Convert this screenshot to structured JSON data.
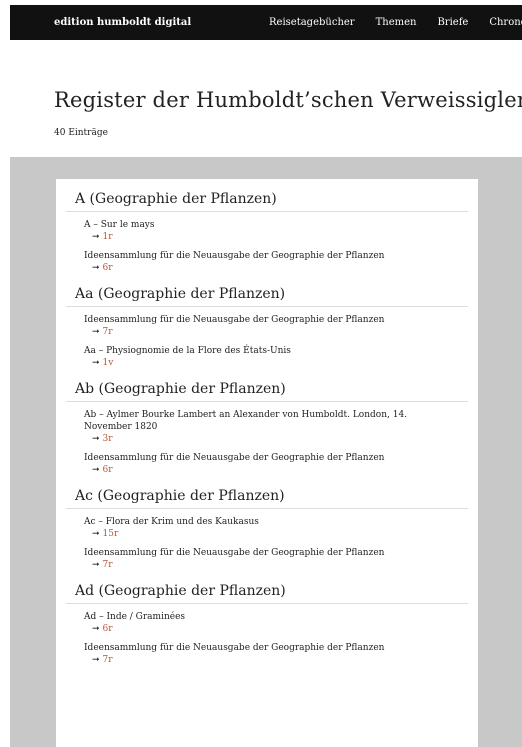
{
  "header": {
    "brand": "edition humboldt digital",
    "nav": [
      "Reisetagebücher",
      "Themen",
      "Briefe",
      "Chronologie"
    ]
  },
  "page": {
    "title": "Register der Humboldt’schen Verweissiglen",
    "count": "40 Einträge"
  },
  "arrow": "➞",
  "groups": [
    {
      "title": "A (Geographie der Pflanzen)",
      "entries": [
        {
          "title": "A – Sur le mays",
          "link": "1r"
        },
        {
          "title": "Ideensammlung für die Neuausgabe der Geographie der Pflanzen",
          "link": "6r"
        }
      ]
    },
    {
      "title": "Aa (Geographie der Pflanzen)",
      "entries": [
        {
          "title": "Ideensammlung für die Neuausgabe der Geographie der Pflanzen",
          "link": "7r"
        },
        {
          "title": "Aa – Physiognomie de la Flore des États-Unis",
          "link": "1v"
        }
      ]
    },
    {
      "title": "Ab (Geographie der Pflanzen)",
      "entries": [
        {
          "title": "Ab – Aylmer Bourke Lambert an Alexander von Humboldt. London, 14. November 1820",
          "link": "3r"
        },
        {
          "title": "Ideensammlung für die Neuausgabe der Geographie der Pflanzen",
          "link": "6r"
        }
      ]
    },
    {
      "title": "Ac (Geographie der Pflanzen)",
      "entries": [
        {
          "title": "Ac – Flora der Krim und des Kaukasus",
          "link": "15r"
        },
        {
          "title": "Ideensammlung für die Neuausgabe der Geographie der Pflanzen",
          "link": "7r"
        }
      ]
    },
    {
      "title": "Ad (Geographie der Pflanzen)",
      "entries": [
        {
          "title": "Ad – Inde / Graminées",
          "link": "6r"
        },
        {
          "title": "Ideensammlung für die Neuausgabe der Geographie der Pflanzen",
          "link": "7r"
        }
      ]
    }
  ]
}
